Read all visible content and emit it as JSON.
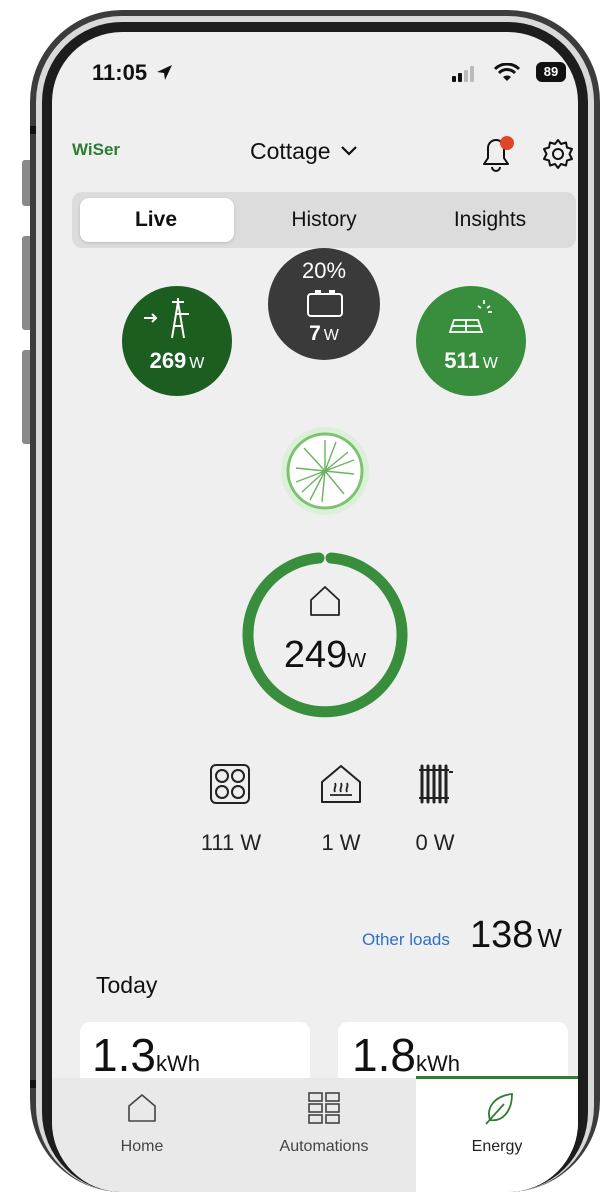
{
  "status_bar": {
    "time": "11:05",
    "battery": "89"
  },
  "header": {
    "brand": "WiSer",
    "location": "Cottage"
  },
  "tabs": [
    {
      "label": "Live",
      "active": true
    },
    {
      "label": "History",
      "active": false
    },
    {
      "label": "Insights",
      "active": false
    }
  ],
  "grid": {
    "value": "269",
    "unit": "W",
    "color": "#1b5e20"
  },
  "battery_node": {
    "percent": "20%",
    "value": "7",
    "unit": "W",
    "color": "#3a3a3a"
  },
  "solar": {
    "value": "511",
    "unit": "W",
    "color": "#388e3c"
  },
  "house": {
    "value": "249",
    "unit": "W"
  },
  "devices": [
    {
      "icon": "cooktop-icon",
      "value": "111 W"
    },
    {
      "icon": "floor-heating-icon",
      "value": "1 W"
    },
    {
      "icon": "radiator-icon",
      "value": "0 W"
    }
  ],
  "other_loads": {
    "label": "Other loads",
    "value": "138",
    "unit": "W"
  },
  "today": {
    "title": "Today"
  },
  "today_cards": [
    {
      "value": "1.3",
      "unit": "kWh"
    },
    {
      "value": "1.8",
      "unit": "kWh"
    }
  ],
  "bottom_nav": [
    {
      "label": "Home",
      "icon": "home-icon",
      "active": false
    },
    {
      "label": "Automations",
      "icon": "grid-icon",
      "active": false
    },
    {
      "label": "Energy",
      "icon": "leaf-icon",
      "active": true
    }
  ],
  "colors": {
    "accent": "#2e7d32",
    "link": "#2d6fc9"
  }
}
